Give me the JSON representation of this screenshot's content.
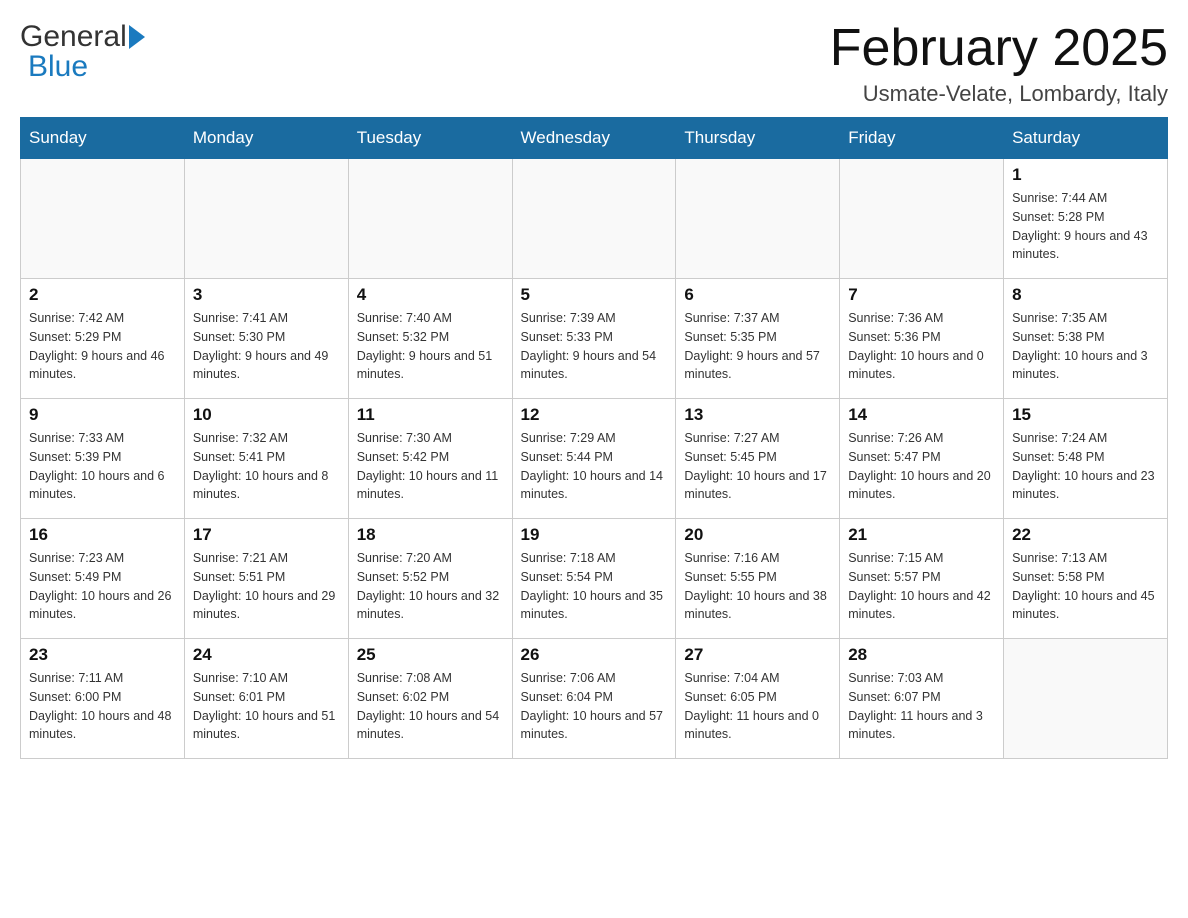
{
  "header": {
    "logo_general": "General",
    "logo_blue": "Blue",
    "title": "February 2025",
    "location": "Usmate-Velate, Lombardy, Italy"
  },
  "days_of_week": [
    "Sunday",
    "Monday",
    "Tuesday",
    "Wednesday",
    "Thursday",
    "Friday",
    "Saturday"
  ],
  "weeks": [
    [
      {
        "day": "",
        "info": ""
      },
      {
        "day": "",
        "info": ""
      },
      {
        "day": "",
        "info": ""
      },
      {
        "day": "",
        "info": ""
      },
      {
        "day": "",
        "info": ""
      },
      {
        "day": "",
        "info": ""
      },
      {
        "day": "1",
        "info": "Sunrise: 7:44 AM\nSunset: 5:28 PM\nDaylight: 9 hours and 43 minutes."
      }
    ],
    [
      {
        "day": "2",
        "info": "Sunrise: 7:42 AM\nSunset: 5:29 PM\nDaylight: 9 hours and 46 minutes."
      },
      {
        "day": "3",
        "info": "Sunrise: 7:41 AM\nSunset: 5:30 PM\nDaylight: 9 hours and 49 minutes."
      },
      {
        "day": "4",
        "info": "Sunrise: 7:40 AM\nSunset: 5:32 PM\nDaylight: 9 hours and 51 minutes."
      },
      {
        "day": "5",
        "info": "Sunrise: 7:39 AM\nSunset: 5:33 PM\nDaylight: 9 hours and 54 minutes."
      },
      {
        "day": "6",
        "info": "Sunrise: 7:37 AM\nSunset: 5:35 PM\nDaylight: 9 hours and 57 minutes."
      },
      {
        "day": "7",
        "info": "Sunrise: 7:36 AM\nSunset: 5:36 PM\nDaylight: 10 hours and 0 minutes."
      },
      {
        "day": "8",
        "info": "Sunrise: 7:35 AM\nSunset: 5:38 PM\nDaylight: 10 hours and 3 minutes."
      }
    ],
    [
      {
        "day": "9",
        "info": "Sunrise: 7:33 AM\nSunset: 5:39 PM\nDaylight: 10 hours and 6 minutes."
      },
      {
        "day": "10",
        "info": "Sunrise: 7:32 AM\nSunset: 5:41 PM\nDaylight: 10 hours and 8 minutes."
      },
      {
        "day": "11",
        "info": "Sunrise: 7:30 AM\nSunset: 5:42 PM\nDaylight: 10 hours and 11 minutes."
      },
      {
        "day": "12",
        "info": "Sunrise: 7:29 AM\nSunset: 5:44 PM\nDaylight: 10 hours and 14 minutes."
      },
      {
        "day": "13",
        "info": "Sunrise: 7:27 AM\nSunset: 5:45 PM\nDaylight: 10 hours and 17 minutes."
      },
      {
        "day": "14",
        "info": "Sunrise: 7:26 AM\nSunset: 5:47 PM\nDaylight: 10 hours and 20 minutes."
      },
      {
        "day": "15",
        "info": "Sunrise: 7:24 AM\nSunset: 5:48 PM\nDaylight: 10 hours and 23 minutes."
      }
    ],
    [
      {
        "day": "16",
        "info": "Sunrise: 7:23 AM\nSunset: 5:49 PM\nDaylight: 10 hours and 26 minutes."
      },
      {
        "day": "17",
        "info": "Sunrise: 7:21 AM\nSunset: 5:51 PM\nDaylight: 10 hours and 29 minutes."
      },
      {
        "day": "18",
        "info": "Sunrise: 7:20 AM\nSunset: 5:52 PM\nDaylight: 10 hours and 32 minutes."
      },
      {
        "day": "19",
        "info": "Sunrise: 7:18 AM\nSunset: 5:54 PM\nDaylight: 10 hours and 35 minutes."
      },
      {
        "day": "20",
        "info": "Sunrise: 7:16 AM\nSunset: 5:55 PM\nDaylight: 10 hours and 38 minutes."
      },
      {
        "day": "21",
        "info": "Sunrise: 7:15 AM\nSunset: 5:57 PM\nDaylight: 10 hours and 42 minutes."
      },
      {
        "day": "22",
        "info": "Sunrise: 7:13 AM\nSunset: 5:58 PM\nDaylight: 10 hours and 45 minutes."
      }
    ],
    [
      {
        "day": "23",
        "info": "Sunrise: 7:11 AM\nSunset: 6:00 PM\nDaylight: 10 hours and 48 minutes."
      },
      {
        "day": "24",
        "info": "Sunrise: 7:10 AM\nSunset: 6:01 PM\nDaylight: 10 hours and 51 minutes."
      },
      {
        "day": "25",
        "info": "Sunrise: 7:08 AM\nSunset: 6:02 PM\nDaylight: 10 hours and 54 minutes."
      },
      {
        "day": "26",
        "info": "Sunrise: 7:06 AM\nSunset: 6:04 PM\nDaylight: 10 hours and 57 minutes."
      },
      {
        "day": "27",
        "info": "Sunrise: 7:04 AM\nSunset: 6:05 PM\nDaylight: 11 hours and 0 minutes."
      },
      {
        "day": "28",
        "info": "Sunrise: 7:03 AM\nSunset: 6:07 PM\nDaylight: 11 hours and 3 minutes."
      },
      {
        "day": "",
        "info": ""
      }
    ]
  ]
}
